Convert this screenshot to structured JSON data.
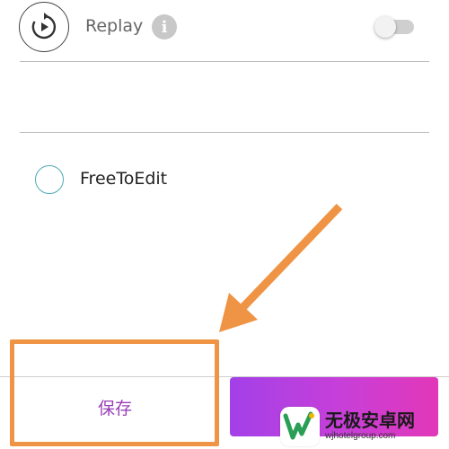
{
  "replay_row": {
    "label": "Replay",
    "icon": "replay-icon",
    "info_icon": "i",
    "toggle_on": false
  },
  "free_to_edit": {
    "label": "FreeToEdit",
    "selected": false
  },
  "bottom_bar": {
    "save_label": "保存",
    "next_label": ""
  },
  "annotation": {
    "highlight_color": "#ef9444"
  },
  "watermark": {
    "title": "无极安卓网",
    "url": "wjhotelgroup.com"
  },
  "colors": {
    "accent_purple": "#9a3fb8",
    "gradient_start": "#a340e8",
    "gradient_end": "#e237b8",
    "radio_border": "#4fa8b8"
  }
}
